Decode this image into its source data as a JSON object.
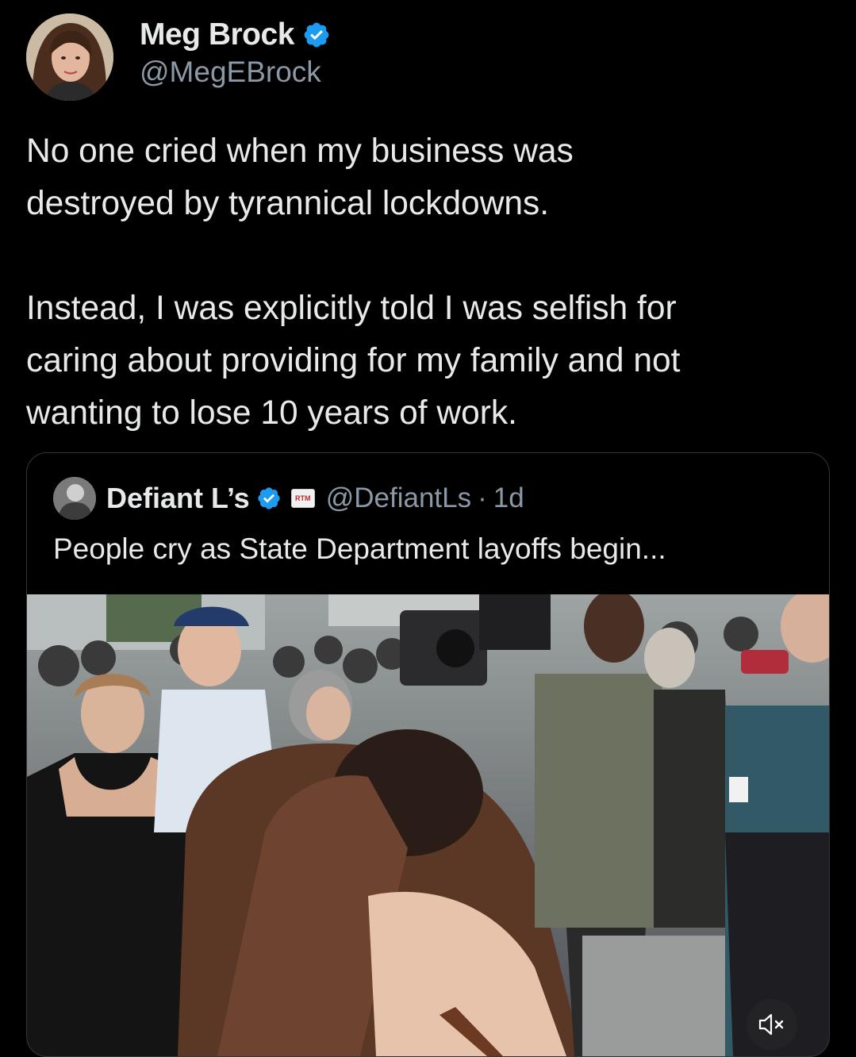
{
  "tweet": {
    "author": {
      "display_name": "Meg Brock",
      "handle": "@MegEBrock",
      "verified": true
    },
    "text": {
      "paragraph1_line1": "No one cried when my business was",
      "paragraph1_line2": "destroyed by tyrannical lockdowns.",
      "paragraph2_line1": "Instead, I was explicitly told I was selfish for",
      "paragraph2_line2": "caring about providing for my family and not",
      "paragraph2_line3": "wanting to lose 10 years of work."
    }
  },
  "quoted_tweet": {
    "author": {
      "display_name": "Defiant L’s",
      "handle": "@DefiantLs",
      "verified": true,
      "affiliate_badge": "RTM"
    },
    "separator": "·",
    "time": "1d",
    "text": "People cry as State Department layoffs begin...",
    "media": {
      "type": "video",
      "muted": true,
      "mute_icon": "speaker-muted-icon"
    }
  },
  "colors": {
    "background": "#000000",
    "primary_text": "#e7e9ea",
    "secondary_text": "#8b98a5",
    "verified_blue": "#1d9bf0",
    "card_border": "#333639"
  }
}
